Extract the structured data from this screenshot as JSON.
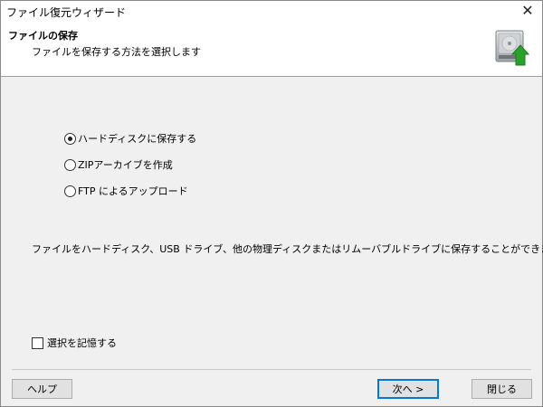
{
  "window": {
    "title": "ファイル復元ウィザード",
    "close_glyph": "✕"
  },
  "header": {
    "title": "ファイルの保存",
    "subtitle": "ファイルを保存する方法を選択します",
    "icon": "hard-drive-export-icon"
  },
  "options": [
    {
      "label": "ハードディスクに保存する",
      "checked": true
    },
    {
      "label": "ZIPアーカイブを作成",
      "checked": false
    },
    {
      "label": "FTP によるアップロード",
      "checked": false
    }
  ],
  "description": "ファイルをハードディスク、USB ドライブ、他の物理ディスクまたはリムーバブルドライブに保存することができます",
  "remember": {
    "label": "選択を記憶する",
    "checked": false
  },
  "buttons": {
    "help": "ヘルプ",
    "next": "次へ >",
    "close": "閉じる"
  },
  "colors": {
    "background": "#f0f0f0",
    "header_bg": "#ffffff",
    "accent": "#0078d7",
    "arrow_green": "#2aa12a"
  }
}
